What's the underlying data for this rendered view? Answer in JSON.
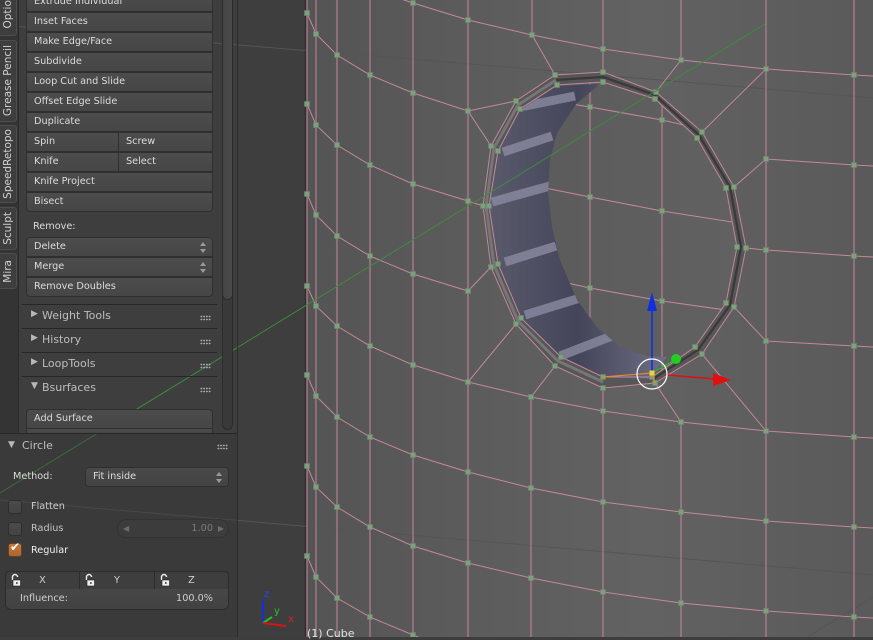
{
  "tabs": [
    {
      "label": "Options"
    },
    {
      "label": "Grease Pencil"
    },
    {
      "label": "SpeedRetopo"
    },
    {
      "label": "Sculpt"
    },
    {
      "label": "Mira"
    }
  ],
  "mesh_tools": {
    "buttons": [
      {
        "label": "Extrude Individual"
      },
      {
        "label": "Inset Faces"
      },
      {
        "label": "Make Edge/Face"
      },
      {
        "label": "Subdivide"
      },
      {
        "label": "Loop Cut and Slide"
      },
      {
        "label": "Offset Edge Slide"
      },
      {
        "label": "Duplicate"
      }
    ],
    "pairs": [
      {
        "left": "Spin",
        "right": "Screw"
      },
      {
        "left": "Knife",
        "right": "Select"
      }
    ],
    "more_buttons": [
      {
        "label": "Knife Project"
      },
      {
        "label": "Bisect"
      }
    ],
    "remove": {
      "label": "Remove:",
      "delete": "Delete",
      "merge": "Merge",
      "remove_doubles": "Remove Doubles"
    }
  },
  "panels": [
    {
      "label": "Weight Tools",
      "expanded": false
    },
    {
      "label": "History",
      "expanded": false
    },
    {
      "label": "LoopTools",
      "expanded": false
    },
    {
      "label": "Bsurfaces",
      "expanded": true
    }
  ],
  "bsurfaces": {
    "add_surface": "Add Surface"
  },
  "operator_panel": {
    "title": "Circle",
    "expanded": true,
    "method_label": "Method:",
    "method_value": "Fit inside",
    "flatten": {
      "label": "Flatten",
      "checked": false
    },
    "radius": {
      "label": "Radius",
      "checked": false,
      "value": "1.00",
      "enabled": false
    },
    "regular": {
      "label": "Regular",
      "checked": true
    },
    "locks": [
      {
        "axis": "X",
        "locked": false
      },
      {
        "axis": "Y",
        "locked": false
      },
      {
        "axis": "Z",
        "locked": false
      }
    ],
    "influence_label": "Influence:",
    "influence_value": "100.0%"
  },
  "glyphs": {
    "collapsed": "▶",
    "expanded": "▼",
    "check": "✔",
    "num_left": "◀",
    "num_right": "▶"
  },
  "icons": {
    "panel_toggle": "triangle-icon",
    "drag_handle": "grip-dots-icon",
    "lock": "lock-open-icon",
    "dropdown": "updown-arrows-icon"
  },
  "viewport": {
    "object_info": "(1) Cube",
    "axis_labels": {
      "x": "x",
      "y": "y",
      "z": "z"
    }
  },
  "colors": {
    "checkbox_accent": "#b8743c",
    "wire_edge": "#c6879c",
    "vertex": "#7fa07d",
    "axis_x": "#e01010",
    "axis_y": "#20c020",
    "axis_z": "#1030e0",
    "grid_x_line": "#3c8c3c"
  }
}
